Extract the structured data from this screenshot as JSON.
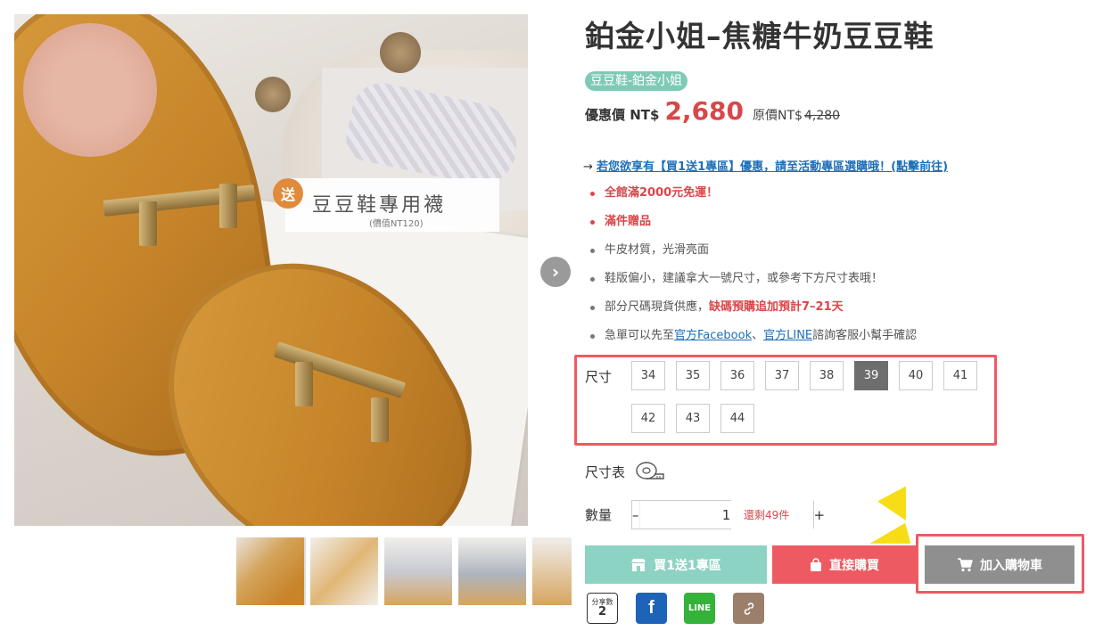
{
  "gallery": {
    "promo_badge": "送",
    "promo_title": "豆豆鞋專用襪",
    "promo_sub": "(價值NT120)",
    "next_glyph": "›",
    "thumb_count": 5
  },
  "product": {
    "title": "鉑金小姐–焦糖牛奶豆豆鞋",
    "tag": "豆豆鞋-鉑金小姐",
    "price_label": "優惠價 NT$",
    "price": "2,680",
    "orig_label": "原價NT$",
    "orig_price": "4,280"
  },
  "promo_link": {
    "arrow": "→",
    "text": "若您欲享有【買1送1專區】優惠，請至活動專區選購哦！(點擊前往)"
  },
  "bullets": {
    "b1": "全館滿2000元免運！",
    "b2": "滿件贈品",
    "b3": "牛皮材質，光滑亮面",
    "b4": "鞋版偏小，建議拿大一號尺寸，或參考下方尺寸表哦！",
    "b5_pre": "部分尺碼現貨供應，",
    "b5_red": "缺碼預購追加預計7–21天",
    "b6_pre": "急單可以先至",
    "b6_link1": "官方Facebook",
    "b6_sep": "、",
    "b6_link2": "官方LINE",
    "b6_post": "諮詢客服小幫手確認"
  },
  "sizes": {
    "label": "尺寸",
    "options": [
      "34",
      "35",
      "36",
      "37",
      "38",
      "39",
      "40",
      "41",
      "42",
      "43",
      "44"
    ],
    "selected": "39"
  },
  "size_chart": {
    "label": "尺寸表",
    "icon": "measuring-tape-icon"
  },
  "quantity": {
    "label": "數量",
    "minus": "–",
    "value": "1",
    "plus": "+",
    "stock": "還剩49件"
  },
  "buttons": {
    "bogo": "買1送1專區",
    "buy_now": "直接購買",
    "add_cart": "加入購物車"
  },
  "share": {
    "count_label": "分享數",
    "count": "2",
    "facebook": "f",
    "line": "LINE",
    "link_icon": "link-icon"
  },
  "colors": {
    "accent_red": "#ee5a62",
    "price_red": "#d9474a",
    "tag_green": "#7ecab7",
    "bogo_teal": "#8dd3c4",
    "cart_gray": "#8f8f8f",
    "link_blue": "#1d6fb8"
  }
}
